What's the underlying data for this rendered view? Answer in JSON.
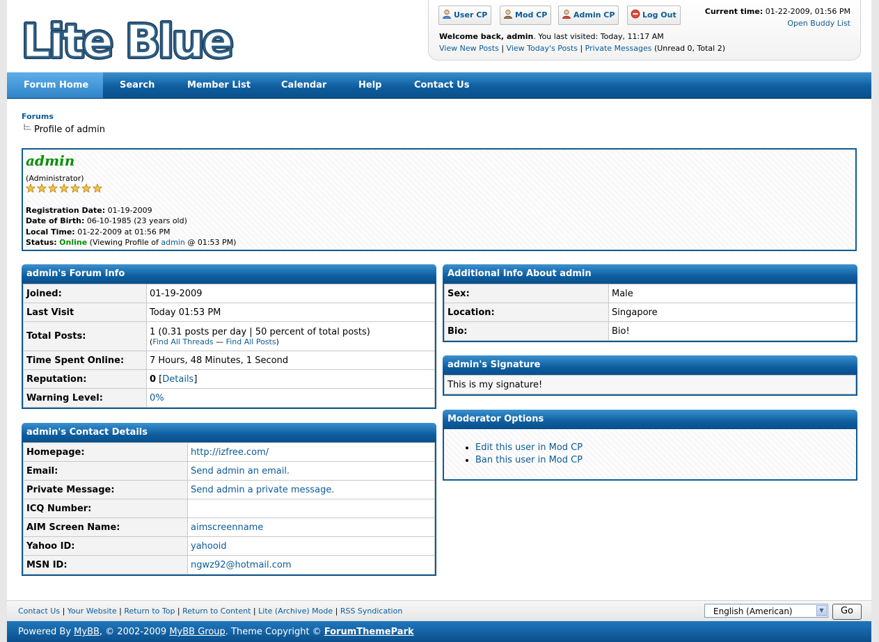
{
  "header": {
    "logo_text": "Lite Blue",
    "buttons": [
      {
        "label": "User CP"
      },
      {
        "label": "Mod CP"
      },
      {
        "label": "Admin CP"
      },
      {
        "label": "Log Out"
      }
    ],
    "current_time_label": "Current time:",
    "current_time_value": "01-22-2009, 01:56 PM",
    "buddy_list": "Open Buddy List",
    "welcome_bold": "Welcome back, admin",
    "welcome_rest": ". You last visited: Today, 11:17 AM",
    "links": {
      "new_posts": "View New Posts",
      "todays_posts": "View Today's Posts",
      "private_messages": "Private Messages",
      "pm_counts": "(Unread 0, Total 2)"
    }
  },
  "nav": {
    "items": [
      "Forum Home",
      "Search",
      "Member List",
      "Calendar",
      "Help",
      "Contact Us"
    ]
  },
  "breadcrumb": {
    "root": "Forums",
    "current": "Profile of admin"
  },
  "profile": {
    "username": "admin",
    "usertitle": "(Administrator)",
    "stars": 7,
    "reg_label": "Registration Date:",
    "reg_value": "01-19-2009",
    "dob_label": "Date of Birth:",
    "dob_value": "06-10-1985 (23 years old)",
    "local_label": "Local Time:",
    "local_value": "01-22-2009 at 01:56 PM",
    "status_label": "Status:",
    "status_value": "Online",
    "status_pre": "(Viewing Profile of",
    "status_user": "admin",
    "status_post": "@ 01:53 PM)",
    "online_color": "#078f07"
  },
  "forum_info": {
    "title": "admin's Forum Info",
    "joined_label": "Joined:",
    "joined_value": "01-19-2009",
    "last_visit_label": "Last Visit",
    "last_visit_value": "Today 01:53 PM",
    "total_posts_label": "Total Posts:",
    "total_posts_value": "1 (0.31 posts per day | 50 percent of total posts)",
    "find_threads": "Find All Threads",
    "find_posts": "Find All Posts",
    "time_online_label": "Time Spent Online:",
    "time_online_value": "7 Hours, 48 Minutes, 1 Second",
    "reputation_label": "Reputation:",
    "reputation_value": "0",
    "reputation_details": "Details",
    "warning_label": "Warning Level:",
    "warning_value": "0%"
  },
  "contact": {
    "title": "admin's Contact Details",
    "rows": [
      {
        "label": "Homepage:",
        "value": "http://izfree.com/"
      },
      {
        "label": "Email:",
        "value": "Send admin an email."
      },
      {
        "label": "Private Message:",
        "value": "Send admin a private message."
      },
      {
        "label": "ICQ Number:",
        "value": ""
      },
      {
        "label": "AIM Screen Name:",
        "value": "aimscreenname"
      },
      {
        "label": "Yahoo ID:",
        "value": "yahooid"
      },
      {
        "label": "MSN ID:",
        "value": "ngwz92@hotmail.com"
      }
    ]
  },
  "additional": {
    "title": "Additional Info About admin",
    "rows": [
      {
        "label": "Sex:",
        "value": "Male"
      },
      {
        "label": "Location:",
        "value": "Singapore"
      },
      {
        "label": "Bio:",
        "value": "Bio!"
      }
    ]
  },
  "signature": {
    "title": "admin's Signature",
    "text": "This is my signature!"
  },
  "moderator": {
    "title": "Moderator Options",
    "items": [
      "Edit this user in Mod CP",
      "Ban this user in Mod CP"
    ]
  },
  "footer": {
    "links": [
      "Contact Us",
      "Your Website",
      "Return to Top",
      "Return to Content",
      "Lite (Archive) Mode",
      "RSS Syndication"
    ],
    "language": "English (American)",
    "go": "Go",
    "powered_pre": "Powered By",
    "mybb": "MyBB",
    "copy_mid": ", © 2002-2009",
    "mybb_group": "MyBB Group",
    "theme_pre": ". Theme Copyright ©",
    "themepark": "ForumThemePark"
  },
  "colors": {
    "accent": "#0e5ea0",
    "link": "#0a5b95",
    "online": "#078f07"
  }
}
